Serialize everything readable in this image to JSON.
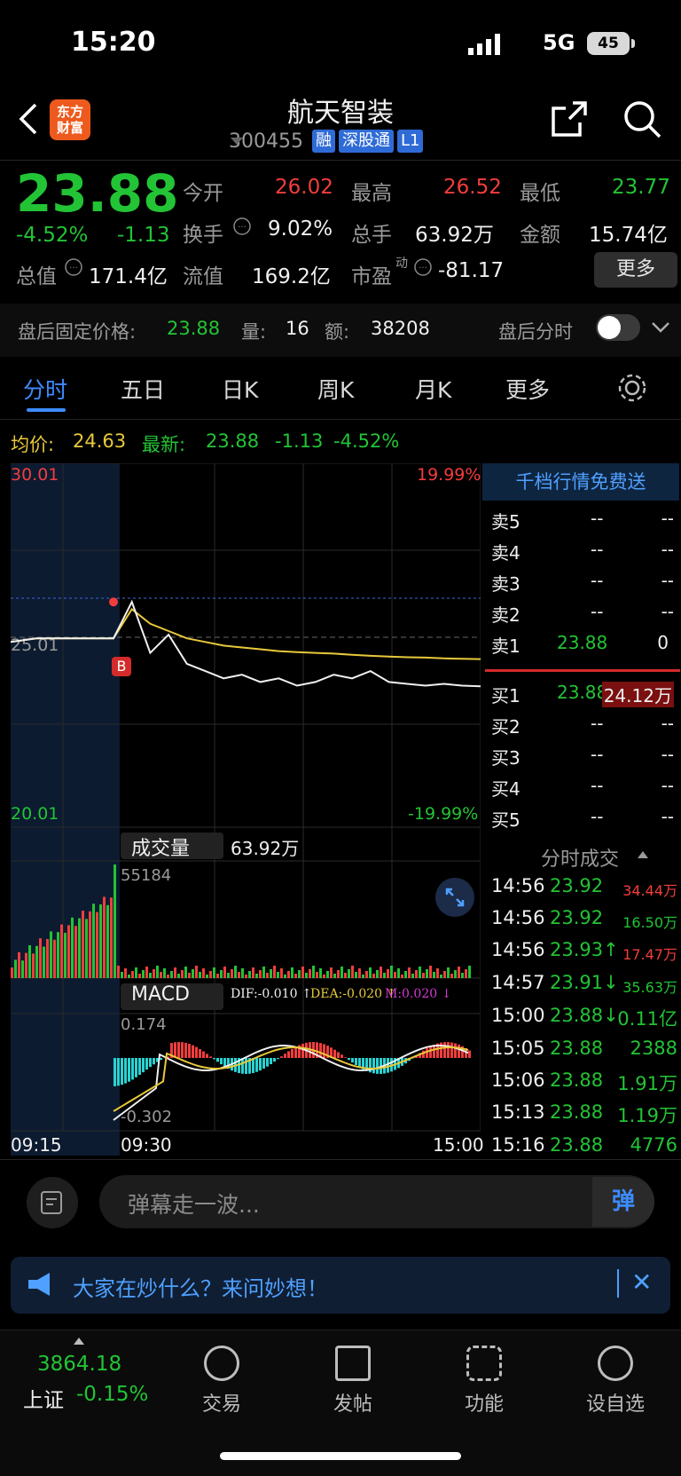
{
  "status_bar": {
    "time": "15:20",
    "network": "5G",
    "battery": "45"
  },
  "header": {
    "logo_line1": "东方",
    "logo_line2": "财富",
    "stock_name": "航天智装",
    "stock_code": "300455",
    "tags": [
      "融",
      "深股通",
      "L1"
    ]
  },
  "quote": {
    "last_price": "23.88",
    "change_pct": "-4.52%",
    "change": "-1.13",
    "open_label": "今开",
    "open": "26.02",
    "high_label": "最高",
    "high": "26.52",
    "low_label": "最低",
    "low": "23.77",
    "turnover_label": "换手",
    "turnover": "9.02%",
    "volume_label": "总手",
    "volume": "63.92万",
    "amount_label": "金额",
    "amount": "15.74亿",
    "mcap_label": "总值",
    "mcap": "171.4亿",
    "float_label": "流值",
    "float": "169.2亿",
    "pe_label": "市盈",
    "pe_sup": "动",
    "pe": "-81.17",
    "more": "更多"
  },
  "after_hours": {
    "label": "盘后固定价格:",
    "price": "23.88",
    "vol_label": "量:",
    "vol": "16",
    "amt_label": "额:",
    "amt": "38208",
    "toggle_label": "盘后分时"
  },
  "tabs": [
    "分时",
    "五日",
    "日K",
    "周K",
    "月K",
    "更多"
  ],
  "chart_header": {
    "avg_label": "均价:",
    "avg": "24.63",
    "latest_label": "最新:",
    "latest": "23.88",
    "change": "-1.13",
    "change_pct": "-4.52%"
  },
  "price_axis": {
    "top": "30.01",
    "mid": "25.01",
    "bottom": "20.01",
    "top_pct": "19.99%",
    "bottom_pct": "-19.99%"
  },
  "volume_panel": {
    "title": "成交量",
    "total": "63.92万",
    "max": "55184"
  },
  "macd_panel": {
    "title": "MACD",
    "dif": "DIF:-0.010 ↑",
    "dea": "DEA:-0.020 ↑",
    "m": "M:0.020 ↓",
    "max": "0.174",
    "min": "-0.302"
  },
  "time_axis": {
    "start": "09:15",
    "open": "09:30",
    "close": "15:00"
  },
  "order_book": {
    "header": "千档行情免费送",
    "asks": [
      {
        "label": "卖5",
        "price": "--",
        "vol": "--"
      },
      {
        "label": "卖4",
        "price": "--",
        "vol": "--"
      },
      {
        "label": "卖3",
        "price": "--",
        "vol": "--"
      },
      {
        "label": "卖2",
        "price": "--",
        "vol": "--"
      },
      {
        "label": "卖1",
        "price": "23.88",
        "vol": "0"
      }
    ],
    "bids": [
      {
        "label": "买1",
        "price": "23.88",
        "vol": "24.12万"
      },
      {
        "label": "买2",
        "price": "--",
        "vol": "--"
      },
      {
        "label": "买3",
        "price": "--",
        "vol": "--"
      },
      {
        "label": "买4",
        "price": "--",
        "vol": "--"
      },
      {
        "label": "买5",
        "price": "--",
        "vol": "--"
      }
    ]
  },
  "ticks": {
    "title": "分时成交",
    "rows": [
      {
        "time": "14:56",
        "price": "23.92",
        "vol": "34.44万"
      },
      {
        "time": "14:56",
        "price": "23.92",
        "vol": "16.50万"
      },
      {
        "time": "14:56",
        "price": "23.93↑",
        "vol": "17.47万"
      },
      {
        "time": "14:57",
        "price": "23.91↓",
        "vol": "35.63万"
      },
      {
        "time": "15:00",
        "price": "23.88↓",
        "vol": "0.11亿"
      },
      {
        "time": "15:05",
        "price": "23.88",
        "vol": "2388"
      },
      {
        "time": "15:06",
        "price": "23.88",
        "vol": "1.91万"
      },
      {
        "time": "15:13",
        "price": "23.88",
        "vol": "1.19万"
      },
      {
        "time": "15:16",
        "price": "23.88",
        "vol": "4776"
      }
    ]
  },
  "comment": {
    "placeholder": "弹幕走一波...",
    "danmu": "弹"
  },
  "banner": {
    "text": "大家在炒什么？来问妙想！"
  },
  "bottom_nav": {
    "index_value": "3864.18",
    "index_name": "上证",
    "index_change": "-0.15%",
    "items": [
      "交易",
      "发帖",
      "功能",
      "设自选"
    ]
  },
  "colors": {
    "up": "#f23d3d",
    "down": "#22c435",
    "avg": "#e8c93a",
    "accent": "#3d8bff"
  },
  "chart_data": {
    "type": "line",
    "series": [
      {
        "values": [
          25.1,
          25.2,
          25.2,
          25.2,
          25.2,
          26.2,
          24.8,
          25.3,
          24.5,
          24.3,
          24.1,
          24.2,
          24.0,
          24.1,
          23.9,
          24.0,
          24.2,
          24.1,
          24.3,
          24.0,
          23.95,
          23.9,
          23.95,
          23.9,
          23.88
        ]
      },
      {
        "values": [
          25.1,
          25.2,
          25.2,
          25.2,
          25.2,
          26.0,
          25.6,
          25.4,
          25.2,
          25.1,
          25.0,
          24.95,
          24.9,
          24.85,
          24.82,
          24.8,
          24.78,
          24.75,
          24.72,
          24.7,
          24.68,
          24.67,
          24.65,
          24.64,
          24.63
        ]
      }
    ],
    "ylim": [
      20.01,
      30.01
    ]
  }
}
